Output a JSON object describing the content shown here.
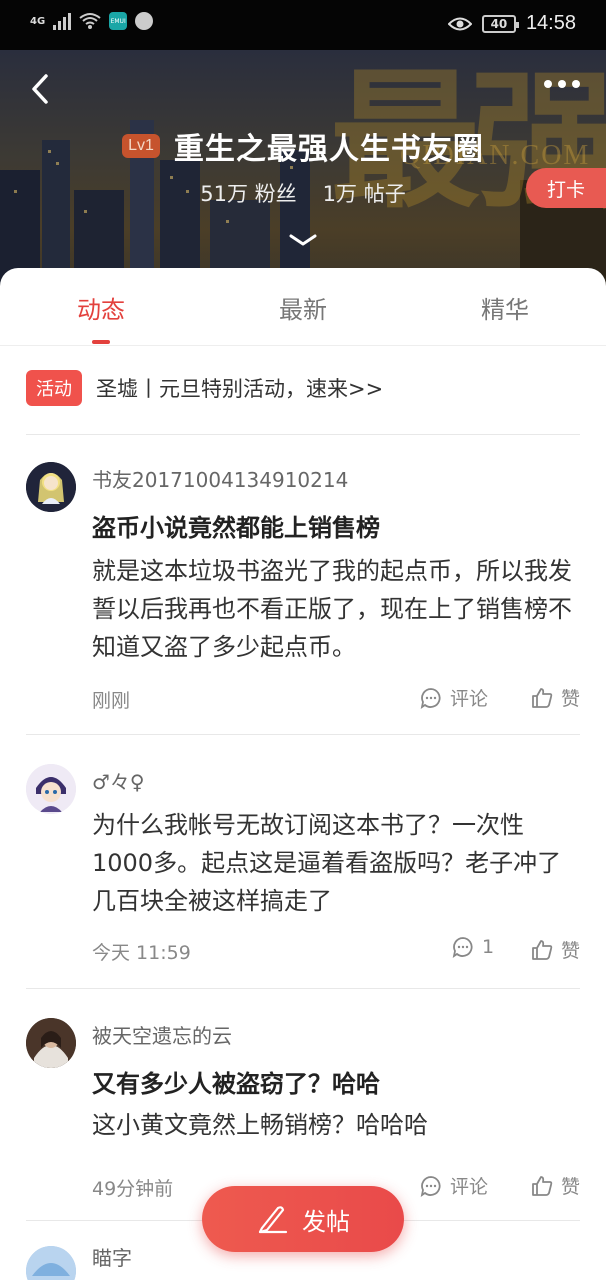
{
  "status_bar": {
    "network": "4G",
    "app_badge": "EMUI",
    "battery": "40",
    "time": "14:58"
  },
  "header": {
    "level": "Lv1",
    "title": "重生之最强人生书友圈",
    "fans": "51万 粉丝",
    "posts": "1万 帖子",
    "checkin_label": "打卡",
    "bg_text_1": "最",
    "bg_text_2": "强",
    "bg_text_3": "QIDIAN.COM"
  },
  "tabs": [
    {
      "label": "动态"
    },
    {
      "label": "最新"
    },
    {
      "label": "精华"
    }
  ],
  "activity": {
    "tag": "活动",
    "text": "圣墟丨元旦特别活动，速来>>"
  },
  "posts": [
    {
      "username": "书友20171004134910214",
      "title": "盗币小说竟然都能上销售榜",
      "body": "就是这本垃圾书盗光了我的起点币，所以我发誓以后我再也不看正版了，现在上了销售榜不知道又盗了多少起点币。",
      "time": "刚刚",
      "comment_label": "评论",
      "like_label": "赞"
    },
    {
      "username": "♂々♀",
      "title": "",
      "body": "为什么我帐号无故订阅这本书了？一次性1000多。起点这是逼着看盗版吗？老子冲了几百块全被这样搞走了",
      "time": "今天 11:59",
      "comment_label": "1",
      "like_label": "赞"
    },
    {
      "username": "被天空遗忘的云",
      "title": "又有多少人被盗窃了？哈哈",
      "body": "这小黄文竟然上畅销榜？哈哈哈",
      "time": "49分钟前",
      "comment_label": "评论",
      "like_label": "赞"
    },
    {
      "username": "瞄字"
    }
  ],
  "fab": {
    "label": "发帖"
  },
  "colors": {
    "accent": "#e3413d",
    "checkin": "#e85a52",
    "level_badge": "#c6532d"
  },
  "icons": [
    "back-icon",
    "more-icon",
    "chevron-down-icon",
    "comment-icon",
    "like-icon",
    "pen-icon",
    "eye-icon",
    "wifi-icon"
  ]
}
